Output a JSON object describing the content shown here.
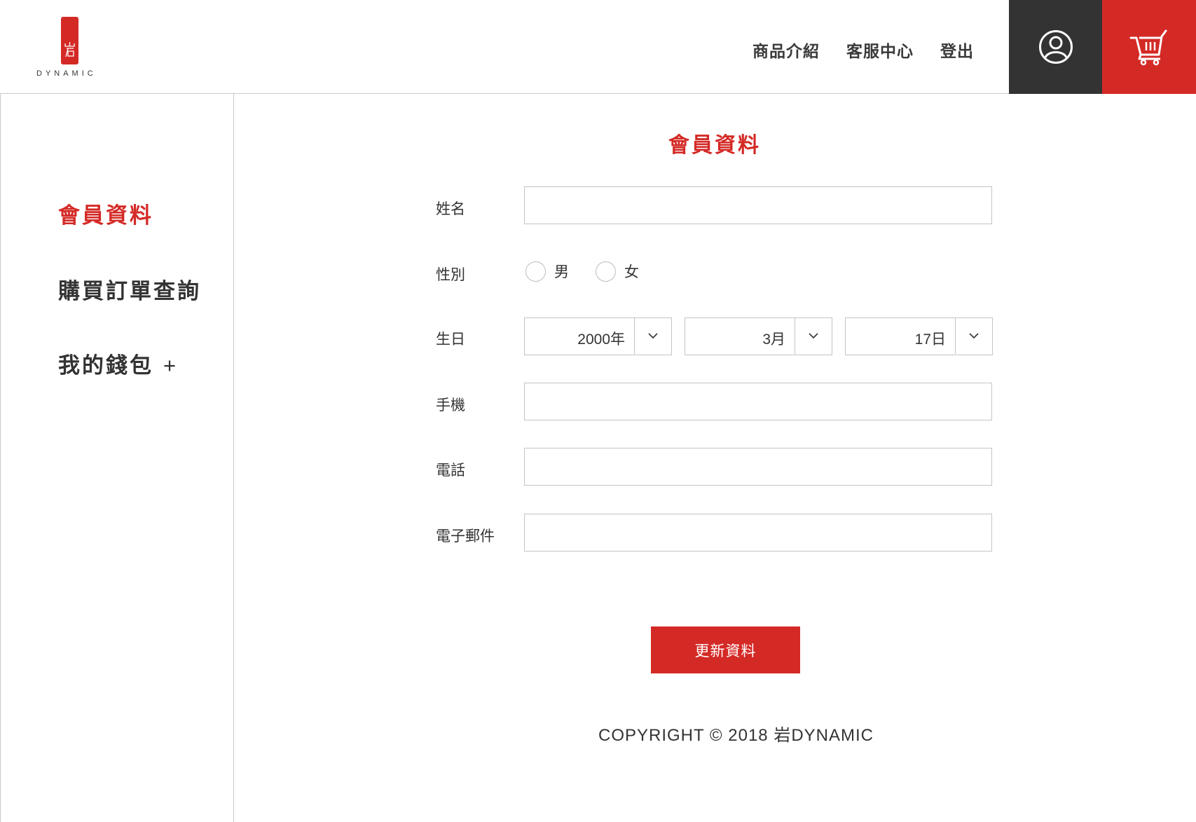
{
  "brand": {
    "logo_text": "DYNAMIC",
    "accent": "#d42a26",
    "dark": "#333333"
  },
  "nav": {
    "items": [
      {
        "label": "商品介紹"
      },
      {
        "label": "客服中心"
      },
      {
        "label": "登出"
      }
    ],
    "user_icon": "user-icon",
    "cart_icon": "cart-icon"
  },
  "sidebar": {
    "items": [
      {
        "label": "會員資料",
        "active": true
      },
      {
        "label": "購買訂單查詢"
      },
      {
        "label": "我的錢包",
        "suffix": "+"
      }
    ]
  },
  "form": {
    "title": "會員資料",
    "name_label": "姓名",
    "name_value": "",
    "gender_label": "性別",
    "gender_options": [
      "男",
      "女"
    ],
    "birthday_label": "生日",
    "birth_year": "2000年",
    "birth_month": "3月",
    "birth_day": "17日",
    "mobile_label": "手機",
    "mobile_value": "",
    "phone_label": "電話",
    "phone_value": "",
    "email_label": "電子郵件",
    "email_value": "",
    "submit_label": "更新資料"
  },
  "footer": {
    "copyright": "COPYRIGHT © 2018 岩DYNAMIC"
  }
}
